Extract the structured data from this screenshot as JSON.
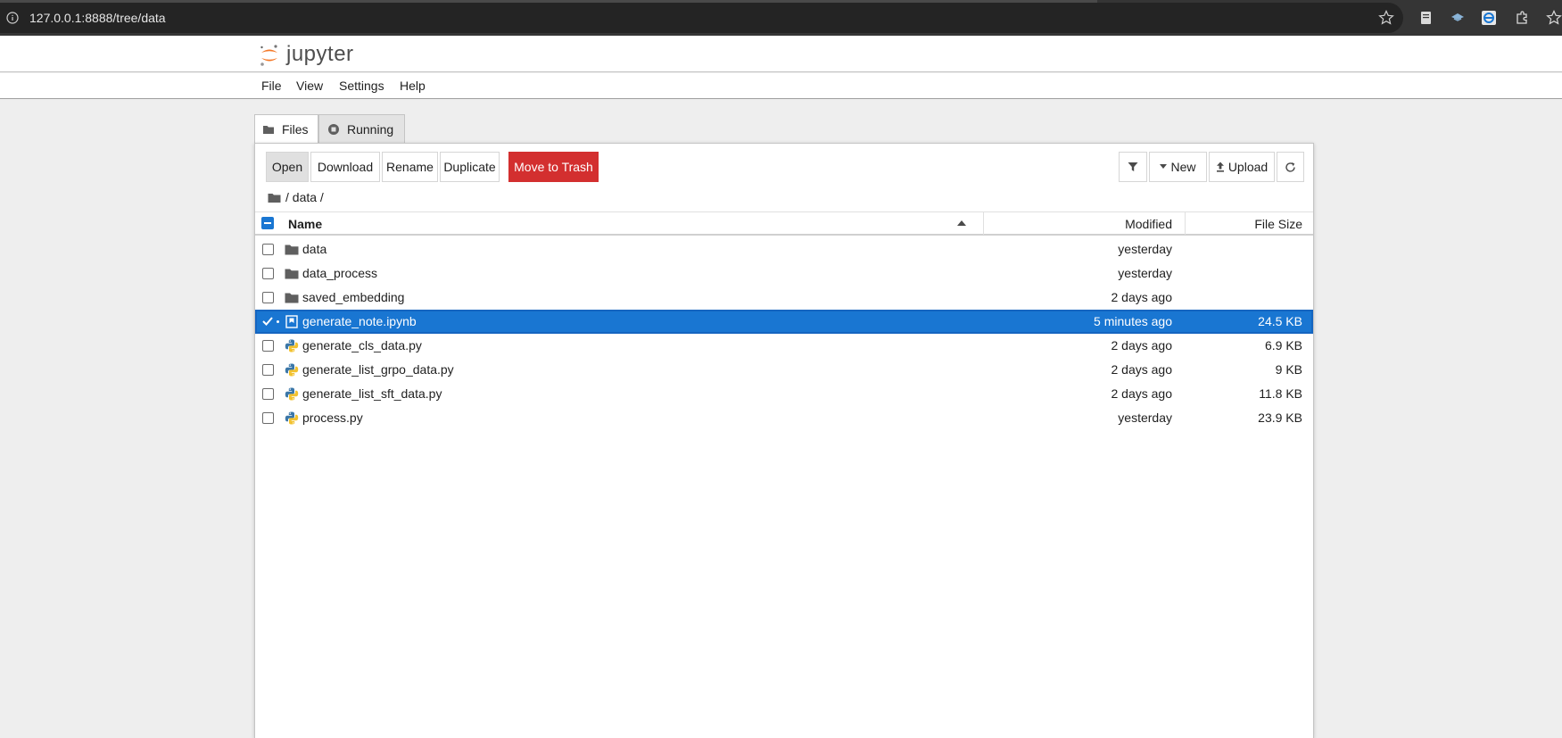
{
  "browser": {
    "url": "127.0.0.1:8888/tree/data"
  },
  "app": {
    "logo_text": "jupyter"
  },
  "menu": {
    "items": [
      "File",
      "View",
      "Settings",
      "Help"
    ]
  },
  "tabs": [
    {
      "label": "Files",
      "icon": "folder-icon",
      "active": true
    },
    {
      "label": "Running",
      "icon": "stop-circle-icon",
      "active": false
    }
  ],
  "toolbar": {
    "open_label": "Open",
    "download_label": "Download",
    "rename_label": "Rename",
    "duplicate_label": "Duplicate",
    "trash_label": "Move to Trash",
    "new_label": "New",
    "upload_label": "Upload"
  },
  "breadcrumb": {
    "path": "/ data /"
  },
  "list": {
    "header_name": "Name",
    "header_modified": "Modified",
    "header_size": "File Size",
    "rows": [
      {
        "name": "data",
        "type": "folder",
        "modified": "yesterday",
        "size": "",
        "selected": false
      },
      {
        "name": "data_process",
        "type": "folder",
        "modified": "yesterday",
        "size": "",
        "selected": false
      },
      {
        "name": "saved_embedding",
        "type": "folder",
        "modified": "2 days ago",
        "size": "",
        "selected": false
      },
      {
        "name": "generate_note.ipynb",
        "type": "notebook",
        "modified": "5 minutes ago",
        "size": "24.5 KB",
        "selected": true
      },
      {
        "name": "generate_cls_data.py",
        "type": "python",
        "modified": "2 days ago",
        "size": "6.9 KB",
        "selected": false
      },
      {
        "name": "generate_list_grpo_data.py",
        "type": "python",
        "modified": "2 days ago",
        "size": "9 KB",
        "selected": false
      },
      {
        "name": "generate_list_sft_data.py",
        "type": "python",
        "modified": "2 days ago",
        "size": "11.8 KB",
        "selected": false
      },
      {
        "name": "process.py",
        "type": "python",
        "modified": "yesterday",
        "size": "23.9 KB",
        "selected": false
      }
    ]
  },
  "colors": {
    "accent": "#1976d2",
    "danger": "#d32f2f",
    "jupyter_orange": "#f37726"
  }
}
